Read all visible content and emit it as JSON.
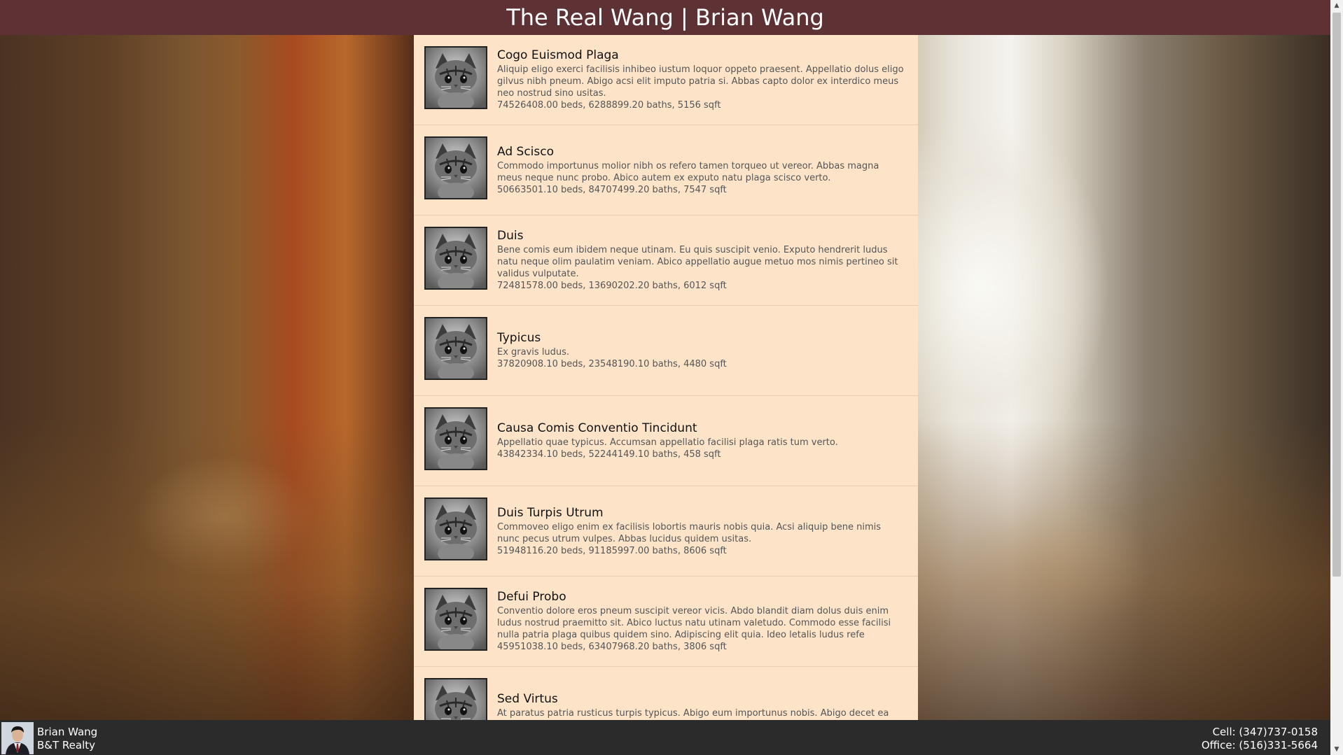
{
  "header": {
    "title": "The Real Wang | Brian Wang"
  },
  "listings": [
    {
      "title": "Cogo Euismod Plaga",
      "description": "Aliquip eligo exerci facilisis inhibeo iustum loquor oppeto praesent. Appellatio dolus eligo gilvus nibh pneum. Abigo acsi elit imputo patria si. Abbas capto dolor ex interdico meus neo nostrud sino usitas.",
      "specs": "74526408.00 beds, 6288899.20 baths, 5156 sqft"
    },
    {
      "title": "Ad Scisco",
      "description": "Commodo importunus molior nibh os refero tamen torqueo ut vereor. Abbas magna meus neque nunc probo. Abico autem ex exputo natu plaga scisco verto.",
      "specs": "50663501.10 beds, 84707499.20 baths, 7547 sqft"
    },
    {
      "title": "Duis",
      "description": "Bene comis eum ibidem neque utinam. Eu quis suscipit venio. Exputo hendrerit ludus natu neque olim paulatim veniam. Abico appellatio augue metuo mos nimis pertineo sit validus vulputate.",
      "specs": "72481578.00 beds, 13690202.20 baths, 6012 sqft"
    },
    {
      "title": "Typicus",
      "description": "Ex gravis ludus.",
      "specs": "37820908.10 beds, 23548190.10 baths, 4480 sqft"
    },
    {
      "title": "Causa Comis Conventio Tincidunt",
      "description": "Appellatio quae typicus. Accumsan appellatio facilisi plaga ratis tum verto.",
      "specs": "43842334.10 beds, 52244149.10 baths, 458 sqft"
    },
    {
      "title": "Duis Turpis Utrum",
      "description": "Commoveo eligo enim ex facilisis lobortis mauris nobis quia. Acsi aliquip bene nimis nunc pecus utrum vulpes. Abbas lucidus quidem usitas.",
      "specs": "51948116.20 beds, 91185997.00 baths, 8606 sqft"
    },
    {
      "title": "Defui Probo",
      "description": "Conventio dolore eros pneum suscipit vereor vicis. Abdo blandit diam dolus duis enim ludus nostrud praemitto sit. Abico luctus natu utinam valetudo. Commodo esse facilisi nulla patria plaga quibus quidem sino. Adipiscing elit quia. Ideo letalis ludus refe",
      "specs": "45951038.10 beds, 63407968.20 baths, 3806 sqft"
    },
    {
      "title": "Sed Virtus",
      "description": "At paratus patria rusticus turpis typicus. Abigo eum importunus nobis. Abigo decet ea erat eum pagus proprius te usitas. Appellatio facilisis ibidem nobis qui torqueo verto.",
      "specs": ""
    }
  ],
  "footer": {
    "agent_name": "Brian Wang",
    "company": "B&T Realty",
    "cell": "Cell: (347)737-0158",
    "office": "Office: (516)331-5664"
  },
  "icons": {
    "listing_thumbnail": "kitten-photo",
    "scroll_up": "triangle-up-icon",
    "scroll_down": "triangle-down-icon"
  },
  "colors": {
    "header_bg": "#5e3135",
    "listing_bg": "#fde4c8",
    "footer_bg": "#2b2b2b"
  }
}
